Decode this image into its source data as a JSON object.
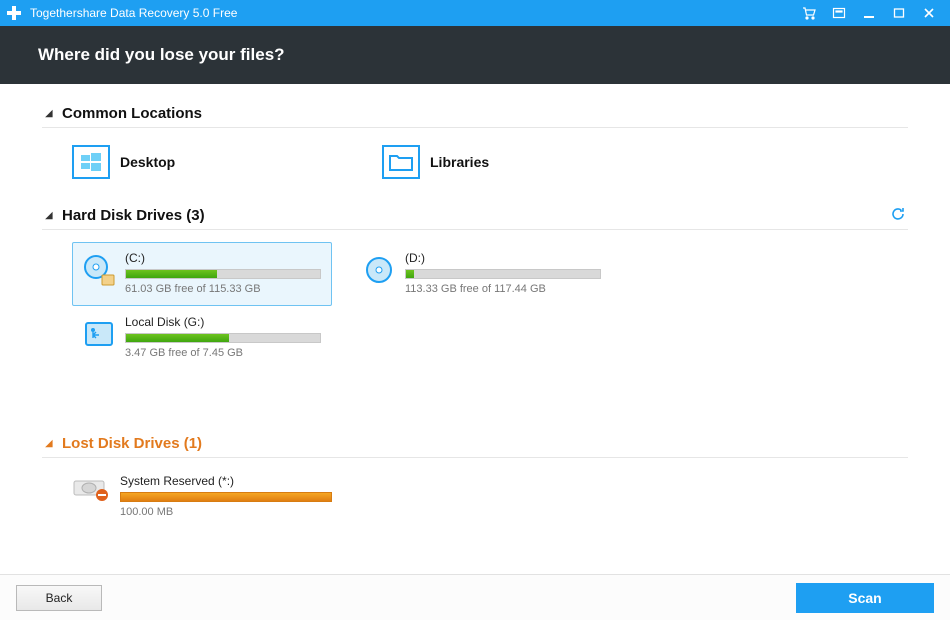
{
  "colors": {
    "accent": "#1e9ff2",
    "header": "#2c3338",
    "lost": "#e27a1e",
    "bar_green": "#6ec31f",
    "bar_orange": "#f5a623"
  },
  "title_bar": {
    "app_title": "Togethershare Data Recovery 5.0 Free"
  },
  "question": "Where did you lose your files?",
  "sections": {
    "common": {
      "title": "Common Locations",
      "items": [
        {
          "label": "Desktop",
          "icon": "windows-icon"
        },
        {
          "label": "Libraries",
          "icon": "folder-icon"
        }
      ]
    },
    "drives": {
      "title": "Hard Disk Drives (3)",
      "items": [
        {
          "name": "(C:)",
          "size_text": "61.03 GB free of 115.33 GB",
          "used_pct": 47,
          "selected": true,
          "icon": "cd-drive-icon"
        },
        {
          "name": "(D:)",
          "size_text": "113.33 GB free of 117.44 GB",
          "used_pct": 4,
          "selected": false,
          "icon": "cd-drive-icon"
        },
        {
          "name": "Local Disk (G:)",
          "size_text": "3.47 GB free of 7.45 GB",
          "used_pct": 53,
          "selected": false,
          "icon": "usb-drive-icon"
        }
      ]
    },
    "lost": {
      "title": "Lost Disk Drives (1)",
      "items": [
        {
          "name": "System Reserved (*:)",
          "size_text": "100.00 MB",
          "used_pct": 100,
          "icon": "drive-removed-icon"
        }
      ]
    }
  },
  "footer": {
    "back_label": "Back",
    "scan_label": "Scan"
  }
}
